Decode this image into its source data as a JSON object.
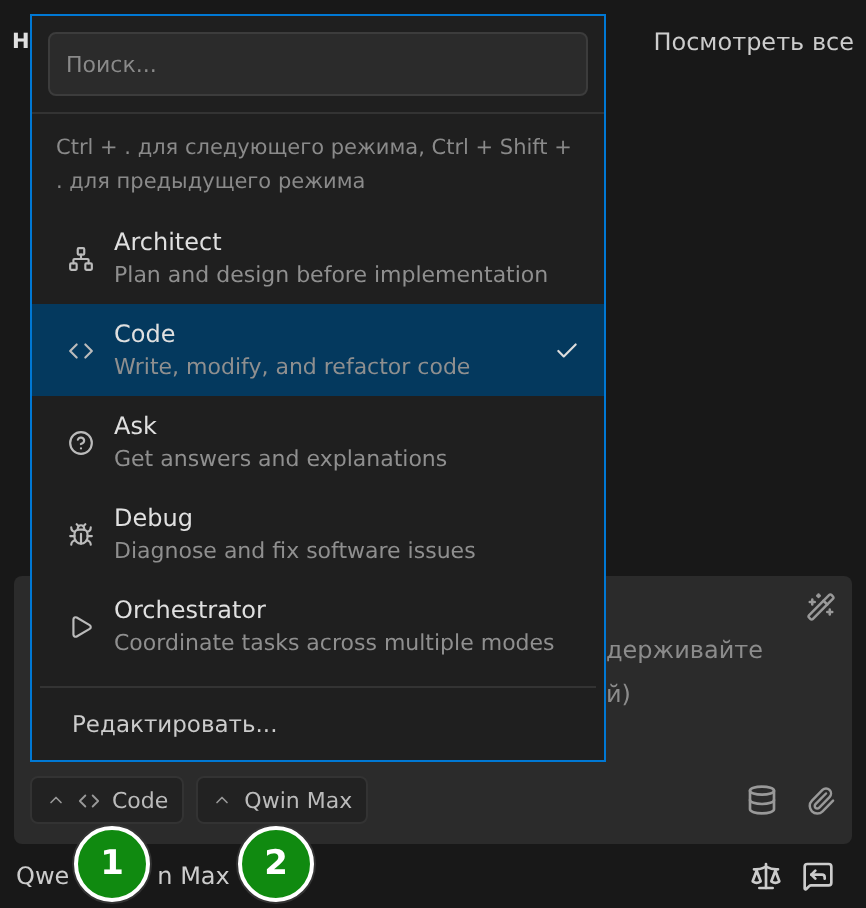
{
  "header": {
    "title": "Н",
    "view_all": "Посмотреть все"
  },
  "composer": {
    "placeholder_lines": [
      "держивайте",
      "й)"
    ],
    "mode_button": {
      "label": "Code"
    },
    "model_button": {
      "label": "Qwin Max"
    }
  },
  "footer": {
    "model_parts": [
      "Qwe",
      "n Max"
    ]
  },
  "badges": [
    "1",
    "2"
  ],
  "mode_menu": {
    "search": {
      "placeholder": "Поиск..."
    },
    "hint": "Ctrl + . для следующего режима, Ctrl + Shift + . для предыдущего режима",
    "items": [
      {
        "kind": "architect",
        "title": "Architect",
        "description": "Plan and design before implementation",
        "selected": false
      },
      {
        "kind": "code",
        "title": "Code",
        "description": "Write, modify, and refactor code",
        "selected": true
      },
      {
        "kind": "ask",
        "title": "Ask",
        "description": "Get answers and explanations",
        "selected": false
      },
      {
        "kind": "debug",
        "title": "Debug",
        "description": "Diagnose and fix software issues",
        "selected": false
      },
      {
        "kind": "orchestrator",
        "title": "Orchestrator",
        "description": "Coordinate tasks across multiple modes",
        "selected": false
      }
    ],
    "edit": "Редактировать..."
  }
}
